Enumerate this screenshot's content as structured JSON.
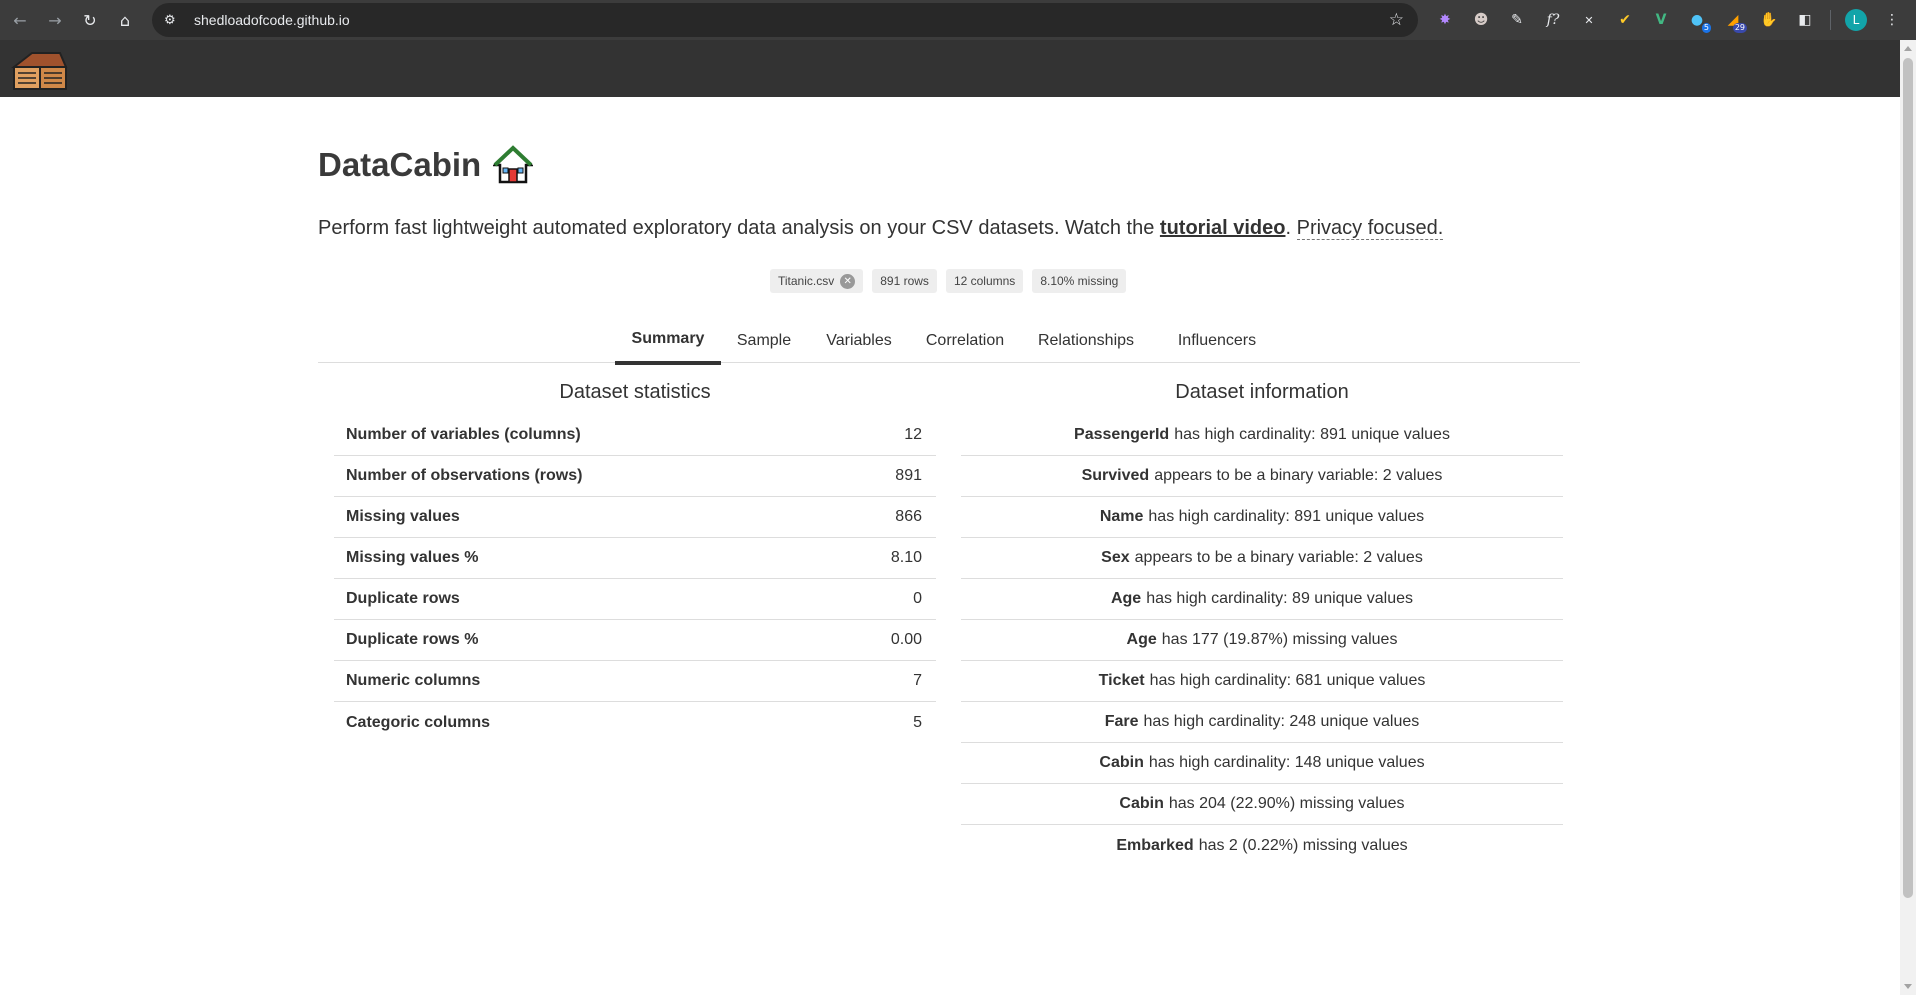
{
  "browser": {
    "url": "shedloadofcode.github.io",
    "extension_badges": {
      "ext6": "5",
      "ext7": "29"
    },
    "profile_initial": "L"
  },
  "app": {
    "title": "DataCabin",
    "tagline_prefix": "Perform fast lightweight automated exploratory data analysis on your CSV datasets. Watch the ",
    "tagline_link": "tutorial video",
    "tagline_sep": ". ",
    "tagline_privacy": "Privacy focused."
  },
  "chips": {
    "file": "Titanic.csv",
    "rows": "891 rows",
    "columns": "12 columns",
    "missing": "8.10% missing"
  },
  "tabs": [
    {
      "label": "Summary",
      "active": true
    },
    {
      "label": "Sample",
      "active": false
    },
    {
      "label": "Variables",
      "active": false
    },
    {
      "label": "Correlation",
      "active": false
    },
    {
      "label": "Relationships",
      "active": false
    },
    {
      "label": "Influencers",
      "active": false
    }
  ],
  "stats": {
    "title": "Dataset statistics",
    "rows": [
      {
        "label": "Number of variables (columns)",
        "value": "12"
      },
      {
        "label": "Number of observations (rows)",
        "value": "891"
      },
      {
        "label": "Missing values",
        "value": "866"
      },
      {
        "label": "Missing values %",
        "value": "8.10"
      },
      {
        "label": "Duplicate rows",
        "value": "0"
      },
      {
        "label": "Duplicate rows %",
        "value": "0.00"
      },
      {
        "label": "Numeric columns",
        "value": "7"
      },
      {
        "label": "Categoric columns",
        "value": "5"
      }
    ]
  },
  "info": {
    "title": "Dataset information",
    "rows": [
      {
        "var": "PassengerId",
        "text": "has high cardinality: 891 unique values"
      },
      {
        "var": "Survived",
        "text": "appears to be a binary variable: 2 values"
      },
      {
        "var": "Name",
        "text": "has high cardinality: 891 unique values"
      },
      {
        "var": "Sex",
        "text": "appears to be a binary variable: 2 values"
      },
      {
        "var": "Age",
        "text": "has high cardinality: 89 unique values"
      },
      {
        "var": "Age",
        "text": "has 177 (19.87%) missing values"
      },
      {
        "var": "Ticket",
        "text": "has high cardinality: 681 unique values"
      },
      {
        "var": "Fare",
        "text": "has high cardinality: 248 unique values"
      },
      {
        "var": "Cabin",
        "text": "has high cardinality: 148 unique values"
      },
      {
        "var": "Cabin",
        "text": "has 204 (22.90%) missing values"
      },
      {
        "var": "Embarked",
        "text": "has 2 (0.22%) missing values"
      }
    ]
  }
}
